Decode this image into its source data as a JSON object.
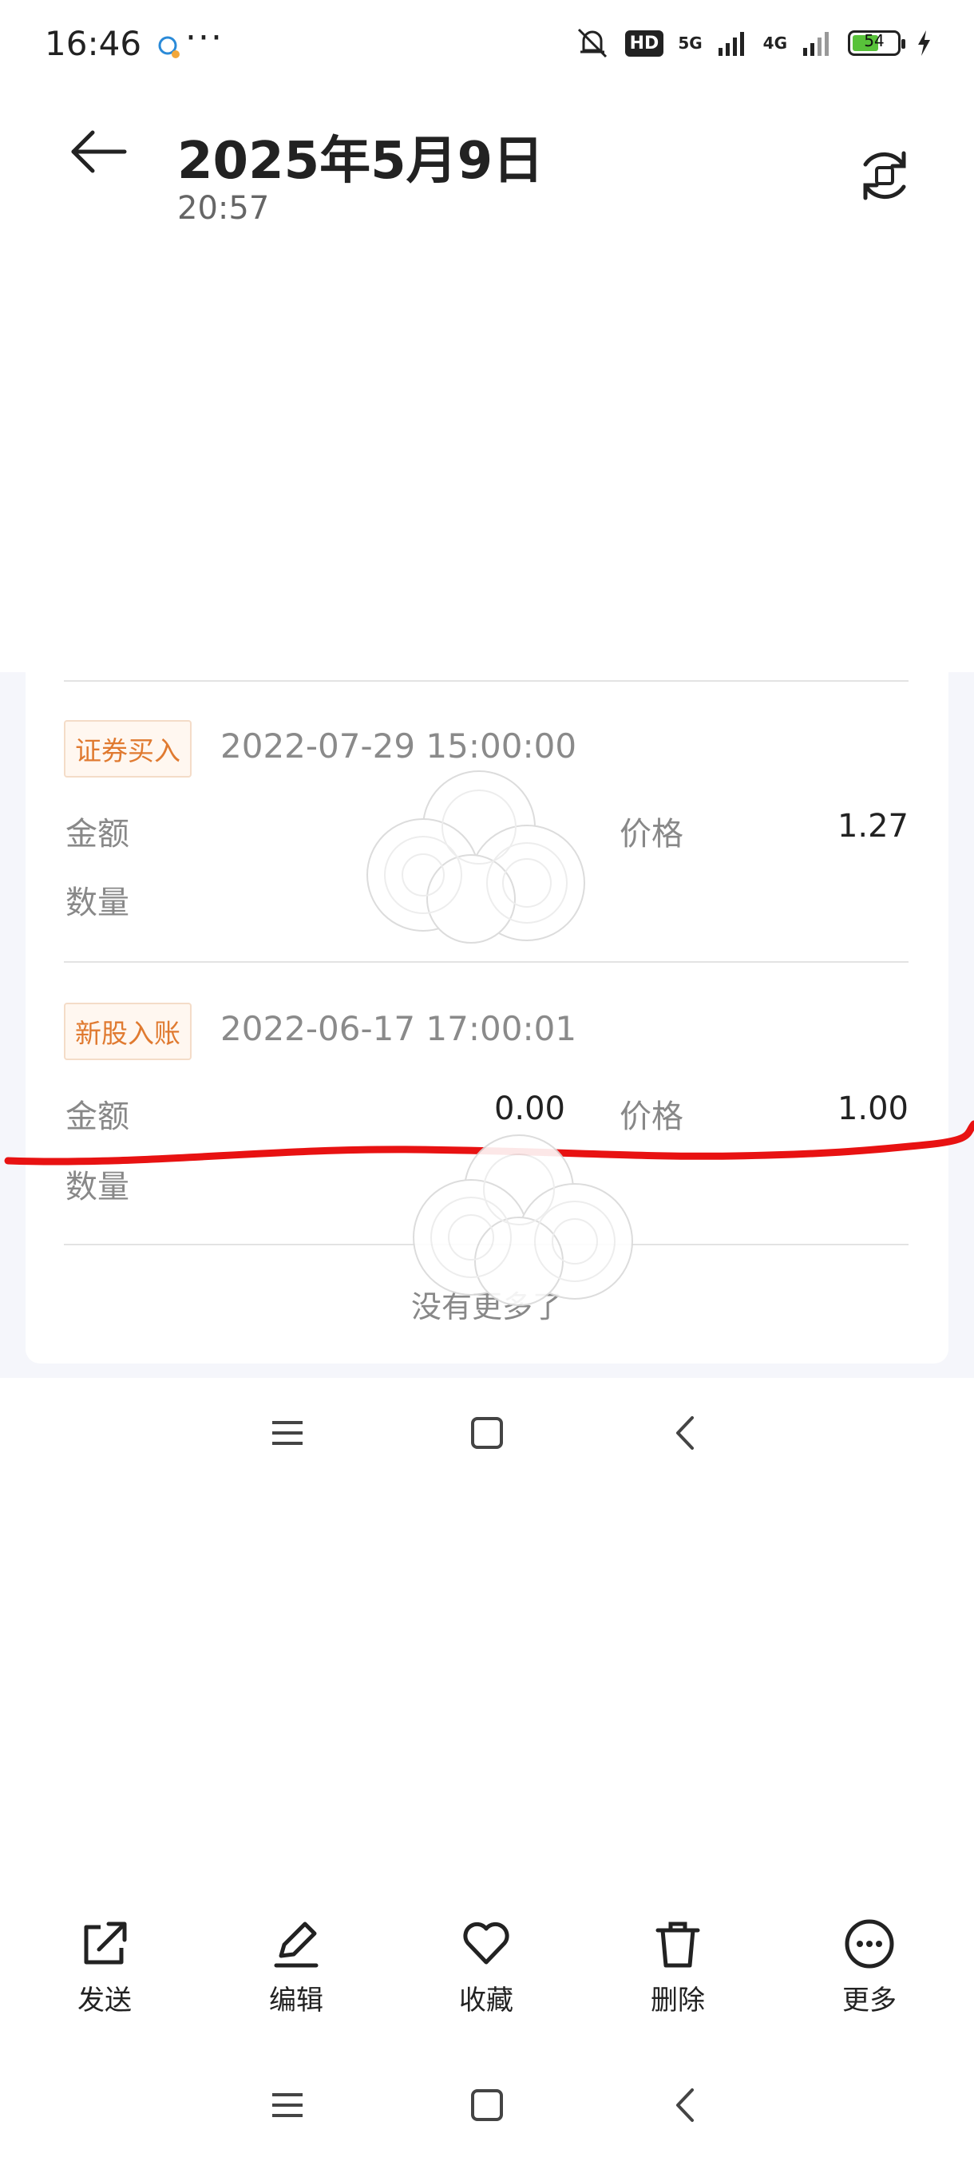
{
  "status_bar": {
    "time": "16:46",
    "more_dots": "···",
    "hd_label": "HD",
    "net_5g": "5G",
    "net_4g": "4G",
    "battery": "54"
  },
  "header": {
    "title": "2025年5月9日",
    "subtitle": "20:57"
  },
  "transactions": [
    {
      "tag": "证券买入",
      "time": "2022-07-29 15:00:00",
      "amount_label": "金额",
      "amount_value": "",
      "price_label": "价格",
      "price_value": "1.27",
      "qty_label": "数量",
      "qty_value": ""
    },
    {
      "tag": "新股入账",
      "time": "2022-06-17 17:00:01",
      "amount_label": "金额",
      "amount_value": "0.00",
      "price_label": "价格",
      "price_value": "1.00",
      "qty_label": "数量",
      "qty_value": ""
    }
  ],
  "no_more": "没有更多了",
  "actions": [
    {
      "label": "发送",
      "icon": "share-icon"
    },
    {
      "label": "编辑",
      "icon": "edit-icon"
    },
    {
      "label": "收藏",
      "icon": "heart-icon"
    },
    {
      "label": "删除",
      "icon": "trash-icon"
    },
    {
      "label": "更多",
      "icon": "more-icon"
    }
  ],
  "colors": {
    "tag_text": "#e07a30",
    "red_mark": "#e81212",
    "battery": "#58c23a"
  }
}
